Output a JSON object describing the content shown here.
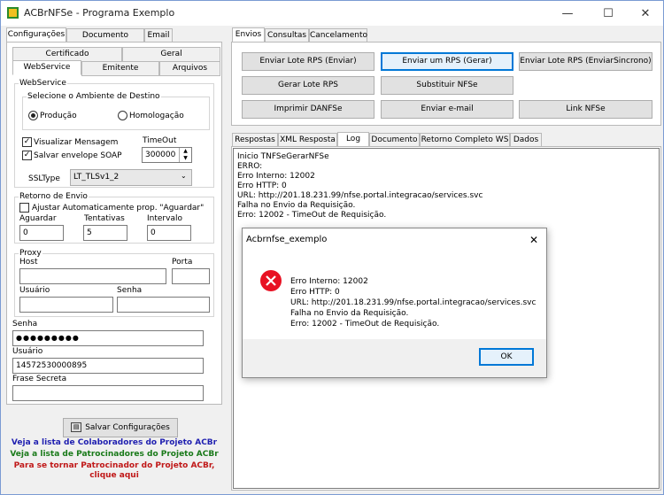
{
  "window": {
    "title": "ACBrNFSe - Programa Exemplo"
  },
  "left_tabs": [
    "Configurações",
    "Documento Auxiliar",
    "Email"
  ],
  "sub_tabs_row1": [
    "Certificado",
    "Geral"
  ],
  "sub_tabs_row2": [
    "WebService",
    "Emitente",
    "Arquivos"
  ],
  "webservice": {
    "group_label": "WebService",
    "ambiente_label": "Selecione o Ambiente de Destino",
    "producao": "Produção",
    "homologacao": "Homologação",
    "visualizar": "Visualizar Mensagem",
    "salvar_envelope": "Salvar envelope SOAP",
    "timeout_label": "TimeOut",
    "timeout_value": "300000",
    "ssltype_label": "SSLType",
    "ssltype_value": "LT_TLSv1_2"
  },
  "retorno": {
    "group_label": "Retorno de Envio",
    "ajustar": "Ajustar Automaticamente prop. \"Aguardar\"",
    "aguardar_label": "Aguardar",
    "aguardar_value": "0",
    "tentativas_label": "Tentativas",
    "tentativas_value": "5",
    "intervalo_label": "Intervalo",
    "intervalo_value": "0"
  },
  "proxy": {
    "group_label": "Proxy",
    "host": "Host",
    "porta": "Porta",
    "usuario": "Usuário",
    "senha": "Senha"
  },
  "credentials": {
    "senha_label": "Senha",
    "senha_value": "●●●●●●●●●",
    "usuario_label": "Usuário",
    "usuario_value": "14572530000895",
    "frase_label": "Frase Secreta",
    "frase_value": ""
  },
  "salvar_config": "Salvar Configurações",
  "links": {
    "colaboradores": "Veja a lista de Colaboradores do Projeto ACBr",
    "patrocinadores": "Veja a lista de Patrocinadores do Projeto ACBr",
    "patrocinador_1": "Para se tornar Patrocinador do Projeto ACBr,",
    "patrocinador_2": "clique aqui"
  },
  "right_tabs": [
    "Envios",
    "Consultas",
    "Cancelamento"
  ],
  "envio_buttons": {
    "enviar_lote": "Enviar Lote RPS (Enviar)",
    "enviar_rps": "Enviar um RPS (Gerar)",
    "enviar_lote_sinc": "Enviar Lote RPS (EnviarSincrono)",
    "gerar_lote": "Gerar Lote RPS",
    "substituir": "Substituir NFSe",
    "imprimir": "Imprimir DANFSe",
    "enviar_email": "Enviar e-mail",
    "link_nfse": "Link NFSe"
  },
  "bottom_tabs": [
    "Respostas",
    "XML Resposta",
    "Log",
    "Documento",
    "Retorno Completo WS",
    "Dados"
  ],
  "log_lines": [
    "Inicio TNFSeGerarNFSe",
    "ERRO:",
    "Erro Interno: 12002",
    "Erro HTTP: 0",
    "URL: http://201.18.231.99/nfse.portal.integracao/services.svc",
    "Falha no Envio da Requisição.",
    "Erro: 12002 - TimeOut de Requisição."
  ],
  "dialog": {
    "title": "Acbrnfse_exemplo",
    "lines": [
      "Erro Interno: 12002",
      "Erro HTTP: 0",
      "URL: http://201.18.231.99/nfse.portal.integracao/services.svc",
      "Falha no Envio da Requisição.",
      "Erro: 12002 - TimeOut de Requisição."
    ],
    "ok": "OK"
  },
  "colors": {
    "link_blue": "#1f1fb0",
    "link_green": "#1a7a1a",
    "link_red": "#c01818",
    "error_red": "#e81123"
  }
}
